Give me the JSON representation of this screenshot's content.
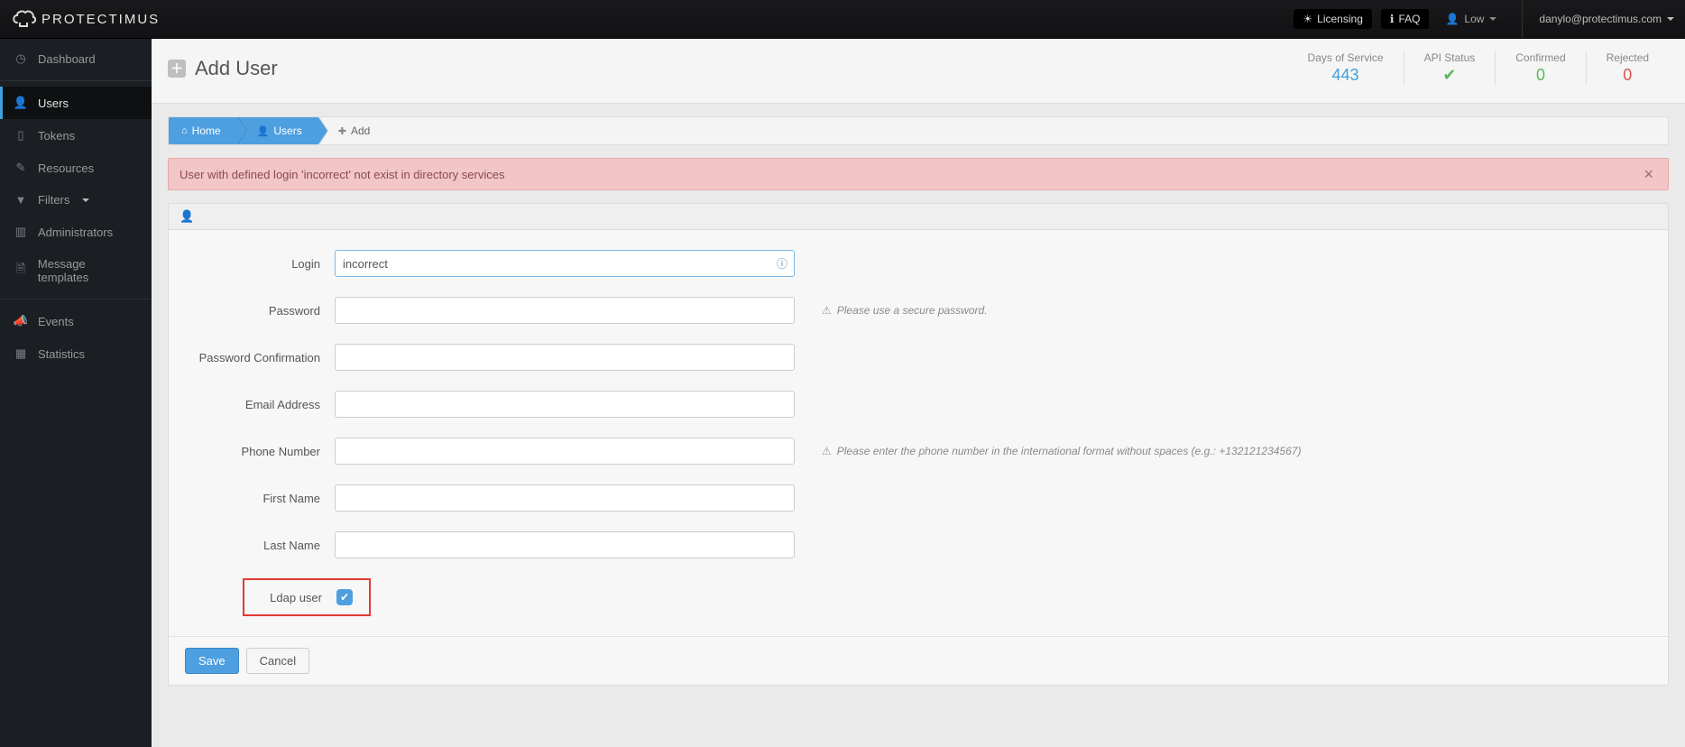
{
  "topbar": {
    "brand": "PROTECTIMUS",
    "licensing": "Licensing",
    "faq": "FAQ",
    "severity_label": "Low",
    "user_email": "danylo@protectimus.com"
  },
  "sidebar": {
    "items": [
      {
        "label": "Dashboard",
        "glyph": "◑",
        "name": "dashboard"
      },
      {
        "label": "Users",
        "glyph": "👤",
        "name": "users",
        "active": true
      },
      {
        "label": "Tokens",
        "glyph": "📱",
        "name": "tokens"
      },
      {
        "label": "Resources",
        "glyph": "✎",
        "name": "resources"
      },
      {
        "label": "Filters",
        "glyph": "▾",
        "name": "filters",
        "dropdown": true
      },
      {
        "label": "Administrators",
        "glyph": "📊",
        "name": "administrators"
      },
      {
        "label": "Message templates",
        "glyph": "🗎",
        "name": "message-templates"
      }
    ],
    "items2": [
      {
        "label": "Events",
        "glyph": "📣",
        "name": "events"
      },
      {
        "label": "Statistics",
        "glyph": "📶",
        "name": "statistics"
      }
    ]
  },
  "page": {
    "title": "Add User"
  },
  "stats": {
    "days_label": "Days of Service",
    "days_value": "443",
    "api_label": "API Status",
    "api_value": "✓",
    "confirmed_label": "Confirmed",
    "confirmed_value": "0",
    "rejected_label": "Rejected",
    "rejected_value": "0"
  },
  "breadcrumb": {
    "home": "Home",
    "users": "Users",
    "add": "Add"
  },
  "alert": {
    "message": "User with defined login 'incorrect' not exist in directory services"
  },
  "form": {
    "login_label": "Login",
    "login_value": "incorrect",
    "password_label": "Password",
    "password_help": "Please use a secure password.",
    "password_confirm_label": "Password Confirmation",
    "email_label": "Email Address",
    "phone_label": "Phone Number",
    "phone_help": "Please enter the phone number in the international format without spaces (e.g.: +132121234567)",
    "first_name_label": "First Name",
    "last_name_label": "Last Name",
    "ldap_label": "Ldap user",
    "save": "Save",
    "cancel": "Cancel"
  }
}
